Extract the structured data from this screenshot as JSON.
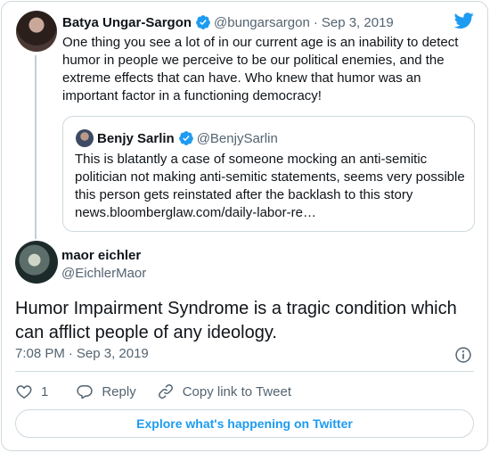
{
  "colors": {
    "accent": "#1d9bf0",
    "text": "#0f1419",
    "muted": "#536471",
    "border": "#cfd9de"
  },
  "icons": [
    "twitter-bird-icon",
    "verified-badge-icon",
    "info-icon",
    "heart-icon",
    "reply-icon",
    "link-icon"
  ],
  "parent_tweet": {
    "author_name": "Batya Ungar-Sargon",
    "handle": "@bungarsargon",
    "separator": "·",
    "date": "Sep 3, 2019",
    "text": "One thing you see a lot of in our current age is an inability to detect humor in people we perceive to be our political enemies, and the extreme effects that can have. Who knew that humor was an important factor in a functioning democracy!"
  },
  "quoted_tweet": {
    "author_name": "Benjy Sarlin",
    "handle": "@BenjySarlin",
    "text": "This is blatantly a case of someone mocking an anti-semitic politician not making anti-semitic statements, seems very possible this person gets reinstated after the backlash to this story news.bloomberglaw.com/daily-labor-re…"
  },
  "main_tweet": {
    "author_name": "maor eichler",
    "handle": "@EichlerMaor",
    "text": "Humor Impairment Syndrome is a tragic condition which can afflict people of any ideology.",
    "time": "7:08 PM",
    "separator": "·",
    "date": "Sep 3, 2019"
  },
  "actions": {
    "like_count": "1",
    "reply_label": "Reply",
    "copy_link_label": "Copy link to Tweet"
  },
  "footer": {
    "explore_label": "Explore what's happening on Twitter"
  }
}
